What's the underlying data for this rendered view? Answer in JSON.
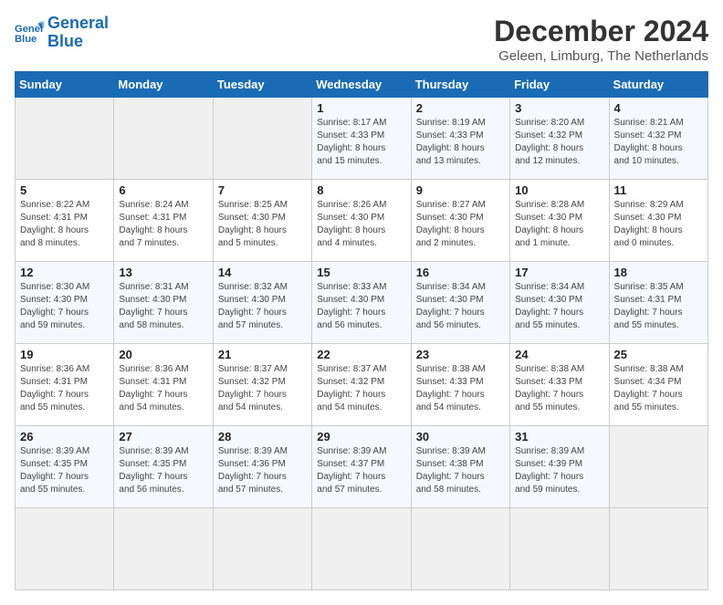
{
  "header": {
    "logo_line1": "General",
    "logo_line2": "Blue",
    "month": "December 2024",
    "location": "Geleen, Limburg, The Netherlands"
  },
  "weekdays": [
    "Sunday",
    "Monday",
    "Tuesday",
    "Wednesday",
    "Thursday",
    "Friday",
    "Saturday"
  ],
  "days": [
    {
      "date": "",
      "info": ""
    },
    {
      "date": "",
      "info": ""
    },
    {
      "date": "",
      "info": ""
    },
    {
      "date": "1",
      "info": "Sunrise: 8:17 AM\nSunset: 4:33 PM\nDaylight: 8 hours\nand 15 minutes."
    },
    {
      "date": "2",
      "info": "Sunrise: 8:19 AM\nSunset: 4:33 PM\nDaylight: 8 hours\nand 13 minutes."
    },
    {
      "date": "3",
      "info": "Sunrise: 8:20 AM\nSunset: 4:32 PM\nDaylight: 8 hours\nand 12 minutes."
    },
    {
      "date": "4",
      "info": "Sunrise: 8:21 AM\nSunset: 4:32 PM\nDaylight: 8 hours\nand 10 minutes."
    },
    {
      "date": "5",
      "info": "Sunrise: 8:22 AM\nSunset: 4:31 PM\nDaylight: 8 hours\nand 8 minutes."
    },
    {
      "date": "6",
      "info": "Sunrise: 8:24 AM\nSunset: 4:31 PM\nDaylight: 8 hours\nand 7 minutes."
    },
    {
      "date": "7",
      "info": "Sunrise: 8:25 AM\nSunset: 4:30 PM\nDaylight: 8 hours\nand 5 minutes."
    },
    {
      "date": "8",
      "info": "Sunrise: 8:26 AM\nSunset: 4:30 PM\nDaylight: 8 hours\nand 4 minutes."
    },
    {
      "date": "9",
      "info": "Sunrise: 8:27 AM\nSunset: 4:30 PM\nDaylight: 8 hours\nand 2 minutes."
    },
    {
      "date": "10",
      "info": "Sunrise: 8:28 AM\nSunset: 4:30 PM\nDaylight: 8 hours\nand 1 minute."
    },
    {
      "date": "11",
      "info": "Sunrise: 8:29 AM\nSunset: 4:30 PM\nDaylight: 8 hours\nand 0 minutes."
    },
    {
      "date": "12",
      "info": "Sunrise: 8:30 AM\nSunset: 4:30 PM\nDaylight: 7 hours\nand 59 minutes."
    },
    {
      "date": "13",
      "info": "Sunrise: 8:31 AM\nSunset: 4:30 PM\nDaylight: 7 hours\nand 58 minutes."
    },
    {
      "date": "14",
      "info": "Sunrise: 8:32 AM\nSunset: 4:30 PM\nDaylight: 7 hours\nand 57 minutes."
    },
    {
      "date": "15",
      "info": "Sunrise: 8:33 AM\nSunset: 4:30 PM\nDaylight: 7 hours\nand 56 minutes."
    },
    {
      "date": "16",
      "info": "Sunrise: 8:34 AM\nSunset: 4:30 PM\nDaylight: 7 hours\nand 56 minutes."
    },
    {
      "date": "17",
      "info": "Sunrise: 8:34 AM\nSunset: 4:30 PM\nDaylight: 7 hours\nand 55 minutes."
    },
    {
      "date": "18",
      "info": "Sunrise: 8:35 AM\nSunset: 4:31 PM\nDaylight: 7 hours\nand 55 minutes."
    },
    {
      "date": "19",
      "info": "Sunrise: 8:36 AM\nSunset: 4:31 PM\nDaylight: 7 hours\nand 55 minutes."
    },
    {
      "date": "20",
      "info": "Sunrise: 8:36 AM\nSunset: 4:31 PM\nDaylight: 7 hours\nand 54 minutes."
    },
    {
      "date": "21",
      "info": "Sunrise: 8:37 AM\nSunset: 4:32 PM\nDaylight: 7 hours\nand 54 minutes."
    },
    {
      "date": "22",
      "info": "Sunrise: 8:37 AM\nSunset: 4:32 PM\nDaylight: 7 hours\nand 54 minutes."
    },
    {
      "date": "23",
      "info": "Sunrise: 8:38 AM\nSunset: 4:33 PM\nDaylight: 7 hours\nand 54 minutes."
    },
    {
      "date": "24",
      "info": "Sunrise: 8:38 AM\nSunset: 4:33 PM\nDaylight: 7 hours\nand 55 minutes."
    },
    {
      "date": "25",
      "info": "Sunrise: 8:38 AM\nSunset: 4:34 PM\nDaylight: 7 hours\nand 55 minutes."
    },
    {
      "date": "26",
      "info": "Sunrise: 8:39 AM\nSunset: 4:35 PM\nDaylight: 7 hours\nand 55 minutes."
    },
    {
      "date": "27",
      "info": "Sunrise: 8:39 AM\nSunset: 4:35 PM\nDaylight: 7 hours\nand 56 minutes."
    },
    {
      "date": "28",
      "info": "Sunrise: 8:39 AM\nSunset: 4:36 PM\nDaylight: 7 hours\nand 57 minutes."
    },
    {
      "date": "29",
      "info": "Sunrise: 8:39 AM\nSunset: 4:37 PM\nDaylight: 7 hours\nand 57 minutes."
    },
    {
      "date": "30",
      "info": "Sunrise: 8:39 AM\nSunset: 4:38 PM\nDaylight: 7 hours\nand 58 minutes."
    },
    {
      "date": "31",
      "info": "Sunrise: 8:39 AM\nSunset: 4:39 PM\nDaylight: 7 hours\nand 59 minutes."
    },
    {
      "date": "",
      "info": ""
    },
    {
      "date": "",
      "info": ""
    },
    {
      "date": "",
      "info": ""
    },
    {
      "date": "",
      "info": ""
    },
    {
      "date": "",
      "info": ""
    }
  ]
}
